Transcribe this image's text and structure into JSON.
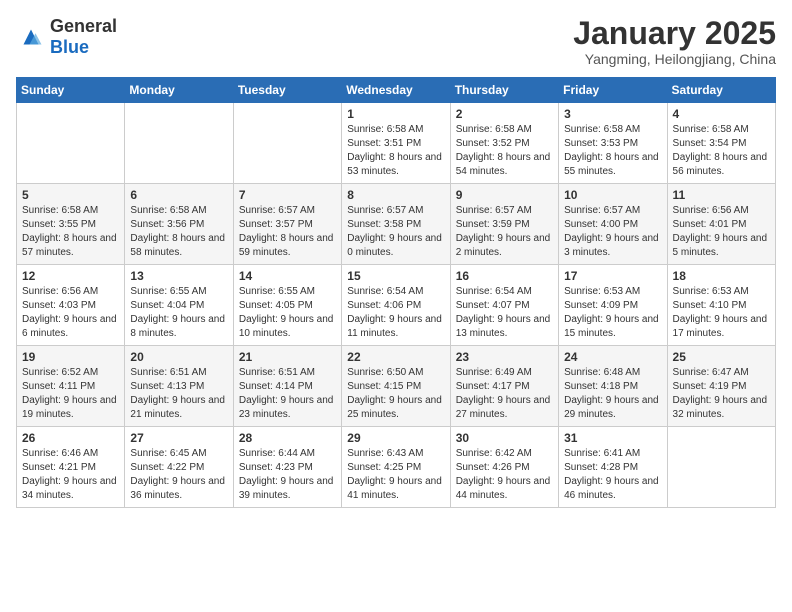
{
  "logo": {
    "general": "General",
    "blue": "Blue"
  },
  "header": {
    "month": "January 2025",
    "location": "Yangming, Heilongjiang, China"
  },
  "days_of_week": [
    "Sunday",
    "Monday",
    "Tuesday",
    "Wednesday",
    "Thursday",
    "Friday",
    "Saturday"
  ],
  "weeks": [
    [
      {
        "day": "",
        "info": ""
      },
      {
        "day": "",
        "info": ""
      },
      {
        "day": "",
        "info": ""
      },
      {
        "day": "1",
        "info": "Sunrise: 6:58 AM\nSunset: 3:51 PM\nDaylight: 8 hours and 53 minutes."
      },
      {
        "day": "2",
        "info": "Sunrise: 6:58 AM\nSunset: 3:52 PM\nDaylight: 8 hours and 54 minutes."
      },
      {
        "day": "3",
        "info": "Sunrise: 6:58 AM\nSunset: 3:53 PM\nDaylight: 8 hours and 55 minutes."
      },
      {
        "day": "4",
        "info": "Sunrise: 6:58 AM\nSunset: 3:54 PM\nDaylight: 8 hours and 56 minutes."
      }
    ],
    [
      {
        "day": "5",
        "info": "Sunrise: 6:58 AM\nSunset: 3:55 PM\nDaylight: 8 hours and 57 minutes."
      },
      {
        "day": "6",
        "info": "Sunrise: 6:58 AM\nSunset: 3:56 PM\nDaylight: 8 hours and 58 minutes."
      },
      {
        "day": "7",
        "info": "Sunrise: 6:57 AM\nSunset: 3:57 PM\nDaylight: 8 hours and 59 minutes."
      },
      {
        "day": "8",
        "info": "Sunrise: 6:57 AM\nSunset: 3:58 PM\nDaylight: 9 hours and 0 minutes."
      },
      {
        "day": "9",
        "info": "Sunrise: 6:57 AM\nSunset: 3:59 PM\nDaylight: 9 hours and 2 minutes."
      },
      {
        "day": "10",
        "info": "Sunrise: 6:57 AM\nSunset: 4:00 PM\nDaylight: 9 hours and 3 minutes."
      },
      {
        "day": "11",
        "info": "Sunrise: 6:56 AM\nSunset: 4:01 PM\nDaylight: 9 hours and 5 minutes."
      }
    ],
    [
      {
        "day": "12",
        "info": "Sunrise: 6:56 AM\nSunset: 4:03 PM\nDaylight: 9 hours and 6 minutes."
      },
      {
        "day": "13",
        "info": "Sunrise: 6:55 AM\nSunset: 4:04 PM\nDaylight: 9 hours and 8 minutes."
      },
      {
        "day": "14",
        "info": "Sunrise: 6:55 AM\nSunset: 4:05 PM\nDaylight: 9 hours and 10 minutes."
      },
      {
        "day": "15",
        "info": "Sunrise: 6:54 AM\nSunset: 4:06 PM\nDaylight: 9 hours and 11 minutes."
      },
      {
        "day": "16",
        "info": "Sunrise: 6:54 AM\nSunset: 4:07 PM\nDaylight: 9 hours and 13 minutes."
      },
      {
        "day": "17",
        "info": "Sunrise: 6:53 AM\nSunset: 4:09 PM\nDaylight: 9 hours and 15 minutes."
      },
      {
        "day": "18",
        "info": "Sunrise: 6:53 AM\nSunset: 4:10 PM\nDaylight: 9 hours and 17 minutes."
      }
    ],
    [
      {
        "day": "19",
        "info": "Sunrise: 6:52 AM\nSunset: 4:11 PM\nDaylight: 9 hours and 19 minutes."
      },
      {
        "day": "20",
        "info": "Sunrise: 6:51 AM\nSunset: 4:13 PM\nDaylight: 9 hours and 21 minutes."
      },
      {
        "day": "21",
        "info": "Sunrise: 6:51 AM\nSunset: 4:14 PM\nDaylight: 9 hours and 23 minutes."
      },
      {
        "day": "22",
        "info": "Sunrise: 6:50 AM\nSunset: 4:15 PM\nDaylight: 9 hours and 25 minutes."
      },
      {
        "day": "23",
        "info": "Sunrise: 6:49 AM\nSunset: 4:17 PM\nDaylight: 9 hours and 27 minutes."
      },
      {
        "day": "24",
        "info": "Sunrise: 6:48 AM\nSunset: 4:18 PM\nDaylight: 9 hours and 29 minutes."
      },
      {
        "day": "25",
        "info": "Sunrise: 6:47 AM\nSunset: 4:19 PM\nDaylight: 9 hours and 32 minutes."
      }
    ],
    [
      {
        "day": "26",
        "info": "Sunrise: 6:46 AM\nSunset: 4:21 PM\nDaylight: 9 hours and 34 minutes."
      },
      {
        "day": "27",
        "info": "Sunrise: 6:45 AM\nSunset: 4:22 PM\nDaylight: 9 hours and 36 minutes."
      },
      {
        "day": "28",
        "info": "Sunrise: 6:44 AM\nSunset: 4:23 PM\nDaylight: 9 hours and 39 minutes."
      },
      {
        "day": "29",
        "info": "Sunrise: 6:43 AM\nSunset: 4:25 PM\nDaylight: 9 hours and 41 minutes."
      },
      {
        "day": "30",
        "info": "Sunrise: 6:42 AM\nSunset: 4:26 PM\nDaylight: 9 hours and 44 minutes."
      },
      {
        "day": "31",
        "info": "Sunrise: 6:41 AM\nSunset: 4:28 PM\nDaylight: 9 hours and 46 minutes."
      },
      {
        "day": "",
        "info": ""
      }
    ]
  ]
}
